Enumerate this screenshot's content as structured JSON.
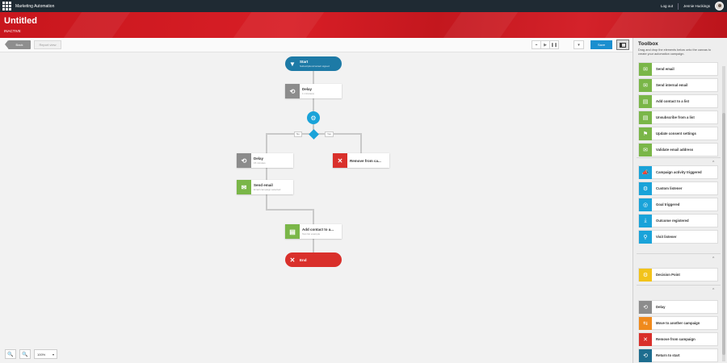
{
  "topbar": {
    "app_name": "Marketing Automation",
    "logout": "Log out",
    "user_name": "Jennie Huckings"
  },
  "header": {
    "title": "Untitled",
    "status": "INACTIVE"
  },
  "toolbar": {
    "back_label": "Back",
    "report_label": "Report view",
    "target_icon": "⌖",
    "play_icon": "▶",
    "pause_icon": "❚❚",
    "dropdown_icon": "▾",
    "save_label": "Save"
  },
  "canvas": {
    "start": {
      "title": "Start",
      "subtitle": "Subscription/contact signed",
      "icon": "▼"
    },
    "delay1": {
      "title": "Delay",
      "subtitle": "1 minute(s)",
      "icon": "⟲"
    },
    "listener_icon": "⚙",
    "branch_no": "No",
    "branch_yes": "Yes",
    "delay2": {
      "title": "Delay",
      "subtitle": "15 minutes",
      "icon": "⟲"
    },
    "remove": {
      "title": "Remove from ca...",
      "subtitle": "",
      "icon": "✕"
    },
    "send_email": {
      "title": "Send email",
      "subtitle": "Email campaign selected",
      "icon": "✉"
    },
    "add_contact": {
      "title": "Add contact to a...",
      "subtitle": "Test list example",
      "icon": "▤"
    },
    "end": {
      "title": "End",
      "icon": "✕"
    },
    "zoom_in_icon": "🔍",
    "zoom_out_icon": "🔍",
    "zoom_level": "100%",
    "zoom_caret": "▾"
  },
  "toolbox": {
    "title": "Toolbox",
    "description": "Drag and drop the elements below onto the canvas to create your automation campaign.",
    "collapse_icon": "^",
    "actions": [
      {
        "label": "Send email",
        "icon": "✉",
        "color": "#7ab648"
      },
      {
        "label": "Send internal email",
        "icon": "✉",
        "color": "#7ab648"
      },
      {
        "label": "Add contact to a list",
        "icon": "▤",
        "color": "#7ab648"
      },
      {
        "label": "Unsubscribe from a list",
        "icon": "▤",
        "color": "#7ab648"
      },
      {
        "label": "Update consent settings",
        "icon": "⚑",
        "color": "#7ab648"
      },
      {
        "label": "Validate email address",
        "icon": "✉",
        "color": "#7ab648"
      }
    ],
    "triggers": [
      {
        "label": "Campaign activity triggered",
        "icon": "📣",
        "color": "#1aa3d9"
      },
      {
        "label": "Custom listener",
        "icon": "⚙",
        "color": "#1aa3d9"
      },
      {
        "label": "Goal triggered",
        "icon": "◎",
        "color": "#1aa3d9"
      },
      {
        "label": "Outcome registered",
        "icon": "⤓",
        "color": "#1aa3d9"
      },
      {
        "label": "Visit listener",
        "icon": "⚲",
        "color": "#1aa3d9"
      }
    ],
    "decisions": [
      {
        "label": "Decision Point",
        "icon": "⚙",
        "color": "#f2c31b"
      }
    ],
    "flow": [
      {
        "label": "Delay",
        "icon": "⟲",
        "color": "#8c8c8c"
      },
      {
        "label": "Move to another campaign",
        "icon": "⇆",
        "color": "#f08a1c"
      },
      {
        "label": "Remove from campaign",
        "icon": "✕",
        "color": "#d9302b"
      },
      {
        "label": "Return to start",
        "icon": "⟲",
        "color": "#1d6d8f"
      }
    ]
  }
}
